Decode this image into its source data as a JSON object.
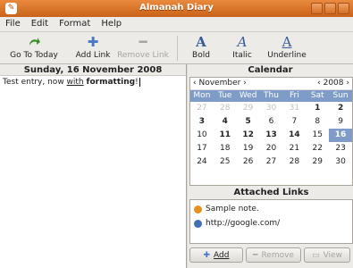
{
  "window": {
    "title": "Almanah Diary",
    "app_icon": "diary-app-icon"
  },
  "menu": [
    "File",
    "Edit",
    "Format",
    "Help"
  ],
  "toolbar": {
    "go_today": "Go To Today",
    "add_link": "Add Link",
    "remove_link": "Remove Link",
    "bold": "Bold",
    "italic": "Italic",
    "underline": "Underline"
  },
  "entry": {
    "date": "Sunday, 16 November 2008",
    "text_prefix": "Test entry, now ",
    "text_underline": "with",
    "text_space": " ",
    "text_bold": "formatting",
    "text_suffix": "!"
  },
  "calendar": {
    "title": "Calendar",
    "month": "November",
    "year": "2008",
    "weekdays": [
      "Mon",
      "Tue",
      "Wed",
      "Thu",
      "Fri",
      "Sat",
      "Sun"
    ],
    "days": [
      {
        "d": "27",
        "out": true
      },
      {
        "d": "28",
        "out": true
      },
      {
        "d": "29",
        "out": true
      },
      {
        "d": "30",
        "out": true
      },
      {
        "d": "31",
        "out": true
      },
      {
        "d": "1",
        "bold": true
      },
      {
        "d": "2",
        "bold": true
      },
      {
        "d": "3",
        "bold": true
      },
      {
        "d": "4",
        "bold": true
      },
      {
        "d": "5",
        "bold": true
      },
      {
        "d": "6"
      },
      {
        "d": "7"
      },
      {
        "d": "8"
      },
      {
        "d": "9"
      },
      {
        "d": "10"
      },
      {
        "d": "11",
        "bold": true
      },
      {
        "d": "12",
        "bold": true
      },
      {
        "d": "13",
        "bold": true
      },
      {
        "d": "14",
        "bold": true
      },
      {
        "d": "15"
      },
      {
        "d": "16",
        "selected": true
      },
      {
        "d": "17"
      },
      {
        "d": "18"
      },
      {
        "d": "19"
      },
      {
        "d": "20"
      },
      {
        "d": "21"
      },
      {
        "d": "22"
      },
      {
        "d": "23"
      },
      {
        "d": "24"
      },
      {
        "d": "25"
      },
      {
        "d": "26"
      },
      {
        "d": "27"
      },
      {
        "d": "28"
      },
      {
        "d": "29"
      },
      {
        "d": "30"
      }
    ]
  },
  "links": {
    "title": "Attached Links",
    "items": [
      {
        "label": "Sample note.",
        "icon": "note-icon",
        "color": "#e8901f"
      },
      {
        "label": "http://google.com/",
        "icon": "globe-icon",
        "color": "#3f6fb5"
      }
    ],
    "add": "Add",
    "remove": "Remove",
    "view": "View"
  },
  "colors": {
    "accent": "#7e9cc7",
    "titlebar": "#d46f26"
  }
}
